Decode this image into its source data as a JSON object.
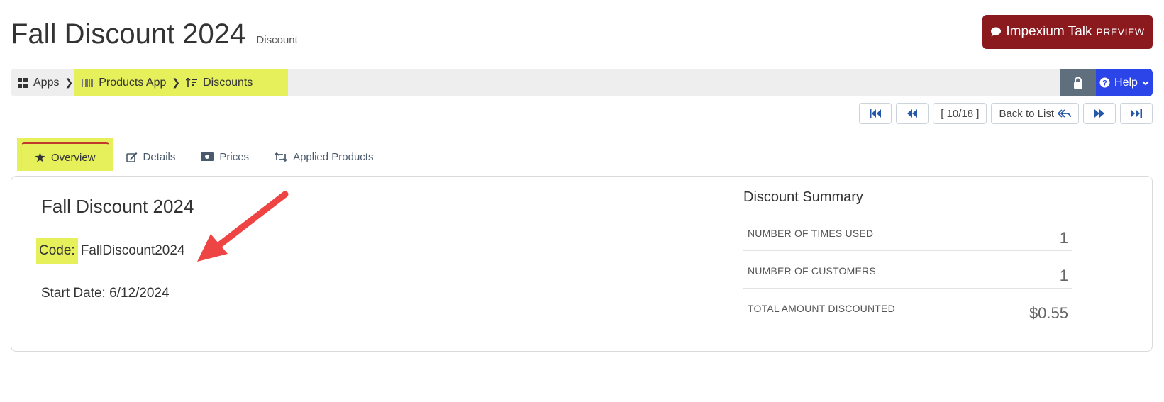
{
  "header": {
    "title": "Fall Discount 2024",
    "subtitle": "Discount"
  },
  "talk_button": {
    "label": "Impexium Talk",
    "badge": "PREVIEW"
  },
  "breadcrumb": {
    "items": [
      {
        "label": "Apps",
        "icon": "grid-icon"
      },
      {
        "label": "Products App",
        "icon": "barcode-icon"
      },
      {
        "label": "Discounts",
        "icon": "sort-icon"
      }
    ]
  },
  "help_button": {
    "label": "Help"
  },
  "pager": {
    "position": "[ 10/18 ]",
    "back_label": "Back to List"
  },
  "tabs": [
    {
      "label": "Overview",
      "icon": "star-icon"
    },
    {
      "label": "Details",
      "icon": "edit-icon"
    },
    {
      "label": "Prices",
      "icon": "money-icon"
    },
    {
      "label": "Applied Products",
      "icon": "retweet-icon"
    }
  ],
  "overview": {
    "name": "Fall Discount 2024",
    "code_label": "Code:",
    "code_value": "FallDiscount2024",
    "start_date": "Start Date: 6/12/2024"
  },
  "summary": {
    "title": "Discount Summary",
    "rows": [
      {
        "label": "NUMBER OF TIMES USED",
        "value": "1"
      },
      {
        "label": "NUMBER OF CUSTOMERS",
        "value": "1"
      },
      {
        "label": "TOTAL AMOUNT DISCOUNTED",
        "value": "$0.55"
      }
    ]
  },
  "colors": {
    "highlight": "#e5f05a",
    "talk_bg": "#8b1a1f",
    "help_bg": "#2b45e8",
    "arrow": "#ee4444"
  }
}
